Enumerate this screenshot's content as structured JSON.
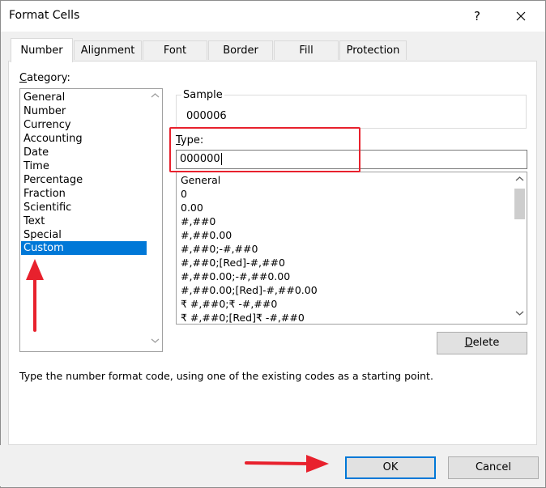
{
  "window": {
    "title": "Format Cells",
    "help": "?"
  },
  "tabs": [
    {
      "label": "Number"
    },
    {
      "label": "Alignment"
    },
    {
      "label": "Font"
    },
    {
      "label": "Border"
    },
    {
      "label": "Fill"
    },
    {
      "label": "Protection"
    }
  ],
  "category": {
    "label_first": "C",
    "label_rest": "ategory:",
    "items": [
      "General",
      "Number",
      "Currency",
      "Accounting",
      "Date",
      "Time",
      "Percentage",
      "Fraction",
      "Scientific",
      "Text",
      "Special",
      "Custom"
    ],
    "selected": "Custom"
  },
  "sample": {
    "label": "Sample",
    "value": "000006"
  },
  "type": {
    "label_first": "T",
    "label_rest": "ype:",
    "value": "000000",
    "formats": [
      "General",
      "0",
      "0.00",
      "#,##0",
      "#,##0.00",
      "#,##0;-#,##0",
      "#,##0;[Red]-#,##0",
      "#,##0.00;-#,##0.00",
      "#,##0.00;[Red]-#,##0.00",
      "₹ #,##0;₹ -#,##0",
      "₹ #,##0;[Red]₹ -#,##0"
    ]
  },
  "delete_button": {
    "first": "D",
    "rest": "elete"
  },
  "description": "Type the number format code, using one of the existing codes as a starting point.",
  "footer": {
    "ok": "OK",
    "cancel": "Cancel"
  },
  "colors": {
    "selection": "#0078d7",
    "annotation": "#e8212d",
    "primary_border": "#0078d7"
  }
}
